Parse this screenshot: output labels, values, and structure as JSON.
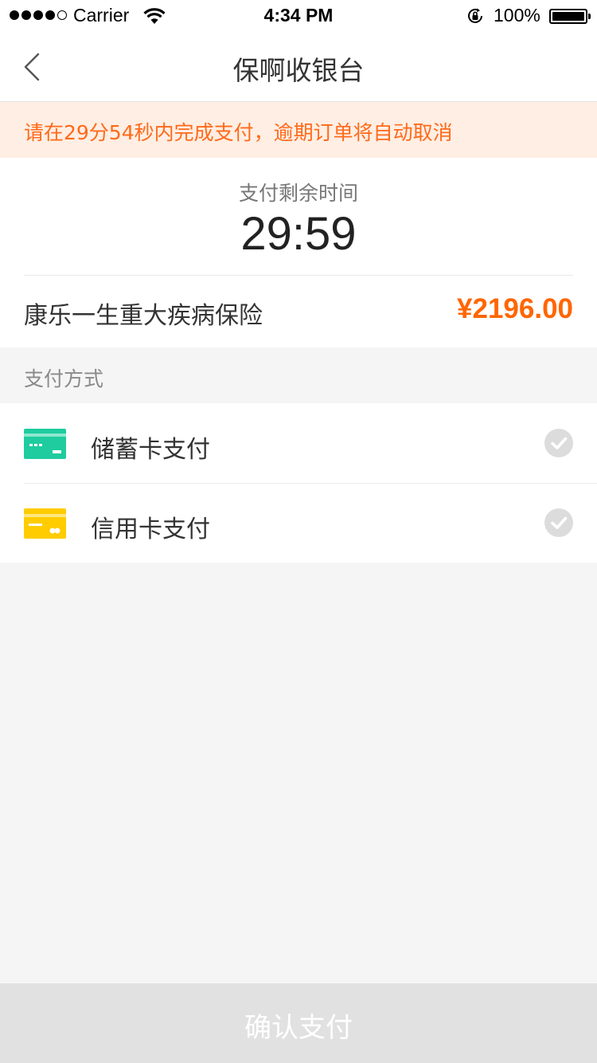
{
  "status_bar": {
    "carrier": "Carrier",
    "time": "4:34 PM",
    "battery": "100%"
  },
  "nav": {
    "title": "保啊收银台"
  },
  "warning": "请在29分54秒内完成支付，逾期订单将自动取消",
  "order": {
    "countdown_label": "支付剩余时间",
    "countdown": "29:59",
    "product": "康乐一生重大疾病保险",
    "price": "¥2196.00"
  },
  "payment": {
    "section_title": "支付方式",
    "methods": [
      {
        "label": "储蓄卡支付",
        "icon": "debit-card-icon",
        "color": "#1ecc9f"
      },
      {
        "label": "信用卡支付",
        "icon": "credit-card-icon",
        "color": "#ffcc00"
      }
    ]
  },
  "confirm_label": "确认支付",
  "colors": {
    "accent": "#ff6600",
    "warning_bg": "#ffeee3",
    "button_disabled": "#e1e1e1"
  }
}
